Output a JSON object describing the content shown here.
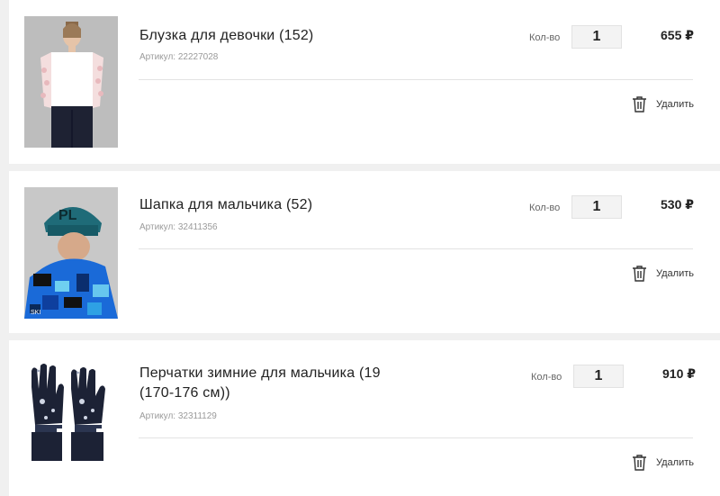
{
  "cart": {
    "qty_label": "Кол-во",
    "delete_label": "Удалить",
    "items": [
      {
        "title": "Блузка для девочки (152)",
        "sku": "Артикул: 22227028",
        "qty": "1",
        "price": "655 ₽",
        "image": "girl-in-white-blouse-photo"
      },
      {
        "title": "Шапка для мальчика (52)",
        "sku": "Артикул: 32411356",
        "qty": "1",
        "price": "530 ₽",
        "image": "boy-in-hat-and-jacket-photo"
      },
      {
        "title": "Перчатки зимние для мальчика (19 (170-176 см))",
        "sku": "Артикул: 32311129",
        "qty": "1",
        "price": "910 ₽",
        "image": "winter-gloves-photo"
      }
    ]
  }
}
